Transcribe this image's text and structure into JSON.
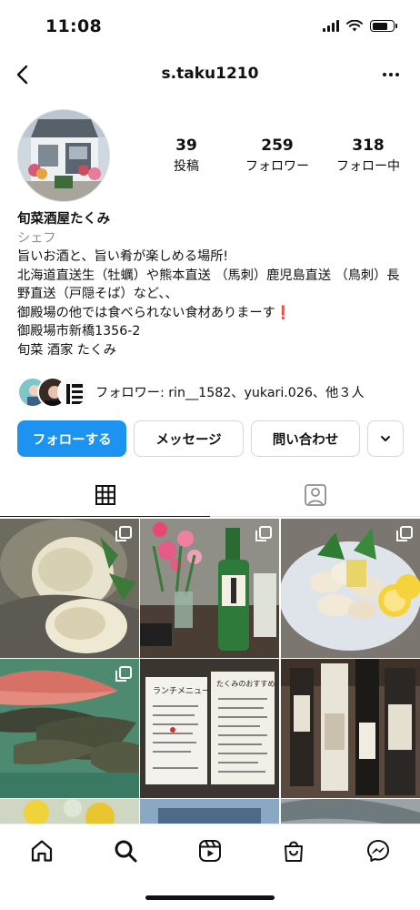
{
  "status_bar": {
    "time": "11:08",
    "battery_level": 0.75
  },
  "header": {
    "username": "s.taku1210"
  },
  "stats": [
    {
      "value": "39",
      "label": "投稿"
    },
    {
      "value": "259",
      "label": "フォロワー"
    },
    {
      "value": "318",
      "label": "フォロー中"
    }
  ],
  "bio": {
    "name": "旬菜酒屋たくみ",
    "category": "シェフ",
    "line1": "旨いお酒と、旨い肴が楽しめる場所!",
    "line2": "北海道直送生（牡蠣）や熊本直送 （馬刺）鹿児島直送 （鳥刺）長野直送（戸隠そば）など、、",
    "line3": "御殿場の他では食べられない食材ありまーす",
    "line3_emoji": "❗",
    "address": "御殿場市新橋1356-2",
    "shop_name": "旬菜 酒家 たくみ"
  },
  "followed_by": {
    "text": "フォロワー: rin__1582、yukari.026、他３人"
  },
  "actions": {
    "follow": "フォローする",
    "message": "メッセージ",
    "contact": "問い合わせ"
  },
  "tabs": [
    {
      "icon": "grid-icon",
      "active": true
    },
    {
      "icon": "tagged-icon",
      "active": false
    }
  ],
  "posts": [
    {
      "subject": "oysters",
      "multi": true
    },
    {
      "subject": "sake-and-flowers",
      "multi": true
    },
    {
      "subject": "chicken-sashimi",
      "multi": true
    },
    {
      "subject": "fresh-fish",
      "multi": true
    },
    {
      "subject": "lunch-menu-board",
      "multi": false
    },
    {
      "subject": "sake-bottles",
      "multi": false
    },
    {
      "subject": "flowers",
      "multi": false
    },
    {
      "subject": "storefront",
      "multi": false
    },
    {
      "subject": "fish",
      "multi": false
    }
  ],
  "lunch_board": {
    "left_title": "ランチメニュー",
    "right_title": "たくみのおすすめ"
  },
  "bottom_nav": [
    "home-icon",
    "search-icon",
    "reels-icon",
    "shop-icon",
    "messenger-icon"
  ],
  "colors": {
    "accent": "#1c93f0",
    "alert": "#e01b24"
  }
}
